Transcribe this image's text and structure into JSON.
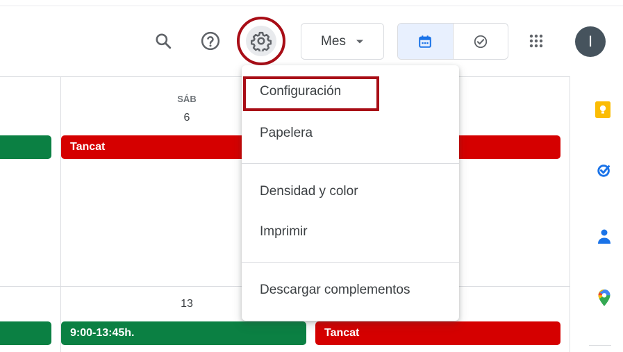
{
  "header": {
    "view_select": {
      "label": "Mes"
    },
    "avatar_initial": "I"
  },
  "calendar": {
    "days": [
      {
        "label": "SÁB",
        "number": "6"
      },
      {
        "label": "",
        "number": "13"
      }
    ],
    "events": {
      "week1_sat": "Tancat",
      "week2_sat": "9:00-13:45h.",
      "week2_sun": "Tancat"
    }
  },
  "settings_menu": {
    "items": [
      "Configuración",
      "Papelera",
      "Densidad y color",
      "Imprimir",
      "Descargar complementos"
    ]
  },
  "colors": {
    "event_green": "#0b8043",
    "event_red": "#d50000",
    "highlight": "#a80d16",
    "active_view": "#e8f0fe"
  }
}
